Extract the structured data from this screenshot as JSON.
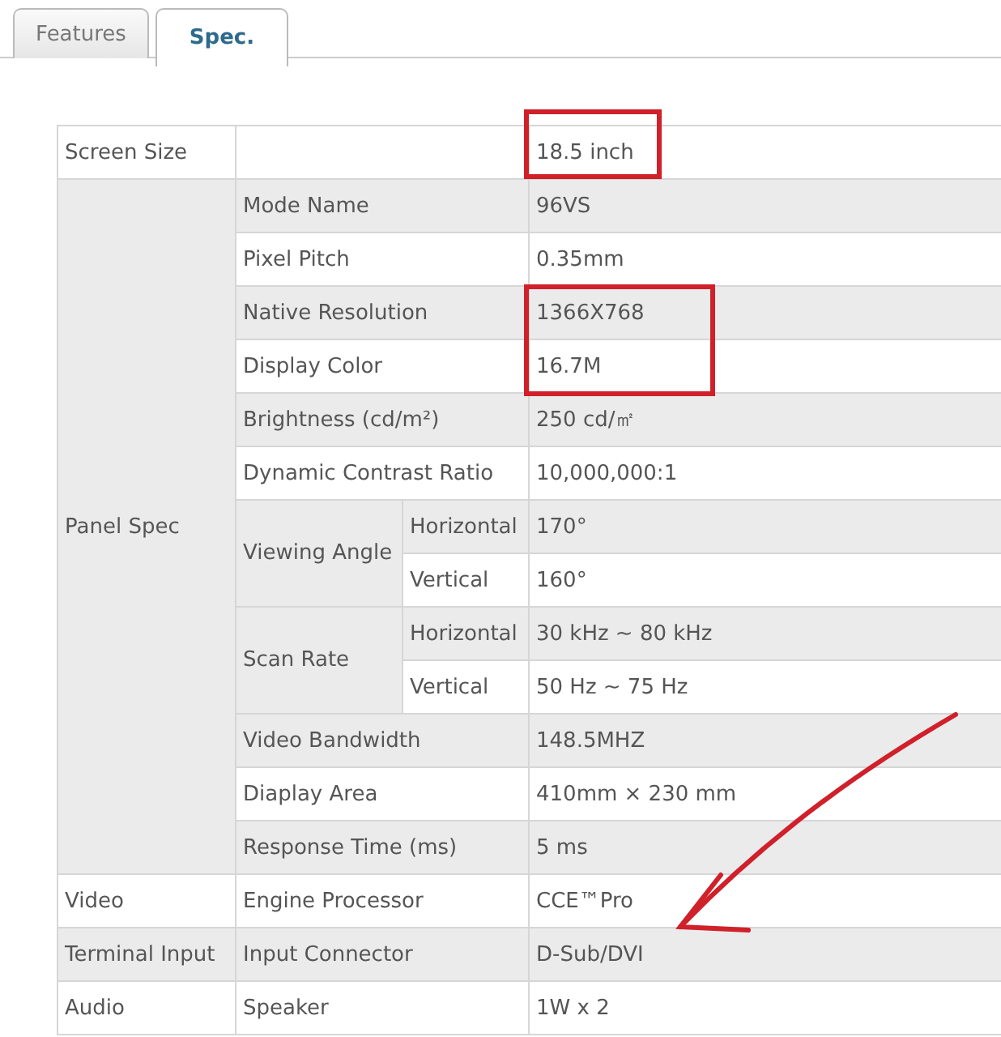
{
  "tabs": [
    {
      "label": "Features",
      "selected": false
    },
    {
      "label": "Spec.",
      "selected": true
    }
  ],
  "specs": [
    {
      "category": "Screen Size",
      "items": [
        {
          "value": "18.5 inch"
        }
      ]
    },
    {
      "category": "Panel Spec",
      "items": [
        {
          "name": "Mode Name",
          "value": "96VS"
        },
        {
          "name": "Pixel Pitch",
          "value": "0.35mm"
        },
        {
          "name": "Native Resolution",
          "value": "1366X768"
        },
        {
          "name": "Display Color",
          "value": "16.7M"
        },
        {
          "name": "Brightness (cd/m²)",
          "value": "250 cd/㎡"
        },
        {
          "name": "Dynamic Contrast Ratio",
          "value": "10,000,000:1"
        },
        {
          "name": "Viewing Angle",
          "children": [
            {
              "name": "Horizontal",
              "value": "170°"
            },
            {
              "name": "Vertical",
              "value": "160°"
            }
          ]
        },
        {
          "name": "Scan Rate",
          "children": [
            {
              "name": "Horizontal",
              "value": "30 kHz ~ 80 kHz"
            },
            {
              "name": "Vertical",
              "value": "50 Hz ~ 75 Hz"
            }
          ]
        },
        {
          "name": "Video Bandwidth",
          "value": "148.5MHZ"
        },
        {
          "name": "Diaplay Area",
          "value": "410mm × 230 mm"
        },
        {
          "name": "Response Time (ms)",
          "value": "5 ms"
        }
      ]
    },
    {
      "category": "Video",
      "items": [
        {
          "name": "Engine Processor",
          "value": "CCE™Pro"
        }
      ]
    },
    {
      "category": "Terminal Input",
      "items": [
        {
          "name": "Input Connector",
          "value": "D-Sub/DVI"
        }
      ]
    },
    {
      "category": "Audio",
      "items": [
        {
          "name": "Speaker",
          "value": "1W x 2"
        }
      ]
    }
  ]
}
